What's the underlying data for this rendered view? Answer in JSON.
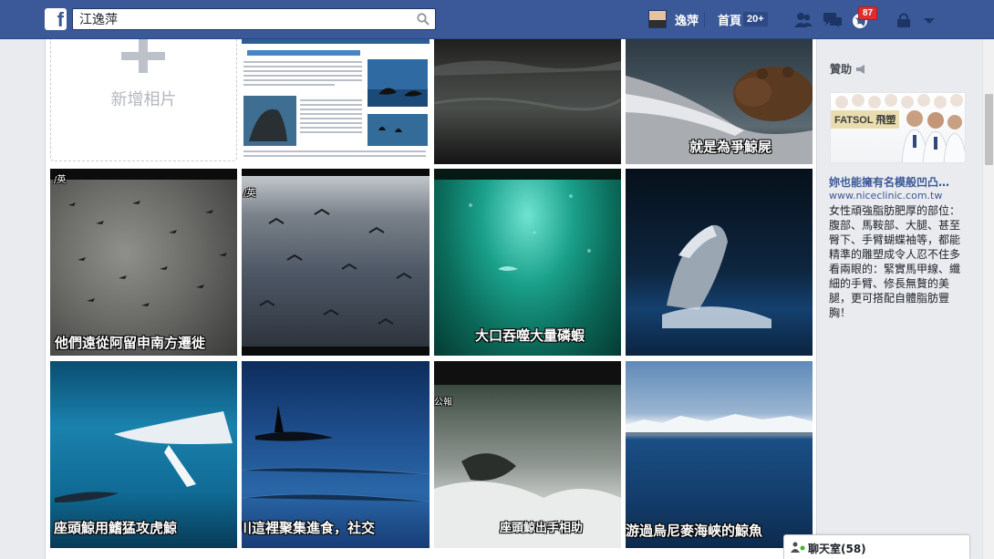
{
  "topbar": {
    "logo_letter": "f",
    "search_value": "江逸萍",
    "profile_name": "逸萍",
    "home_label": "首頁",
    "home_count": "20+",
    "notification_count": "87"
  },
  "album": {
    "add_photo_label": "新增相片",
    "captions": {
      "bear": "就是為爭鯨屍",
      "birds1": "他們遠從阿留申南方遷徙",
      "birds2_corner": "/英",
      "birds1_corner": "/英",
      "green": "大口吞噬大量磷蝦",
      "humpback": "座頭鯨用鰭猛攻虎鯨",
      "orca": "川這裡聚集進食，社交",
      "splash": "座頭鯨出手相助",
      "splash_corner": "公報",
      "straits": "游過烏尼麥海峽的鯨魚"
    }
  },
  "sidebar": {
    "sponsor_title": "贊助",
    "ad": {
      "brand": "FATSOL 飛塑",
      "title": "妳也能擁有名模般凹凸…",
      "url": "www.niceclinic.com.tw",
      "body": "女性頑強脂肪肥厚的部位：腹部、馬鞍部、大腿、甚至臀下、手臂蝴蝶袖等，都能精準的雕塑成令人忍不住多看兩眼的：緊實馬甲線、纖細的手臂、修長無贅的美腿，更可搭配自體脂肪豐胸！"
    }
  },
  "chat": {
    "label": "聊天室(58)"
  },
  "colors": {
    "brand_blue": "#3b5998",
    "badge_red": "#e02e2e",
    "page_bg": "#e9ebee"
  }
}
